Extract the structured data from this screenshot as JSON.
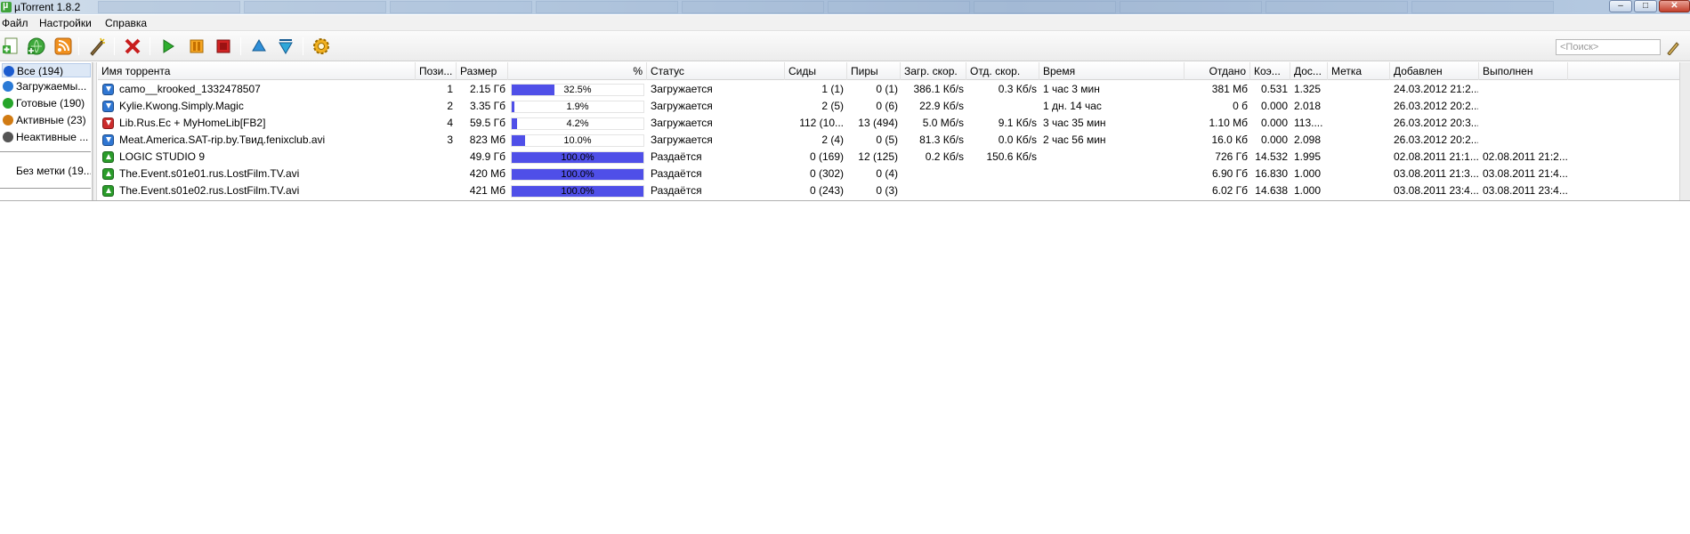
{
  "window": {
    "title": "µTorrent 1.8.2",
    "min": "–",
    "max": "□",
    "close": "✕"
  },
  "menu": [
    "Файл",
    "Настройки",
    "Справка"
  ],
  "toolbar": {
    "search_placeholder": "<Поиск>",
    "icons": [
      "add-torrent-icon",
      "add-url-icon",
      "rss-icon",
      "create-torrent-icon",
      "remove-icon",
      "start-icon",
      "pause-icon",
      "stop-icon",
      "move-up-icon",
      "move-down-icon",
      "settings-icon"
    ]
  },
  "sidebar": {
    "items": [
      {
        "label": "Все (194)",
        "icon": "#1c5ccf",
        "selected": true
      },
      {
        "label": "Загружаемы...",
        "icon": "#2a7ad6"
      },
      {
        "label": "Готовые (190)",
        "icon": "#26a52a"
      },
      {
        "label": "Активные (23)",
        "icon": "#d17b13"
      },
      {
        "label": "Неактивные ...",
        "icon": "#555555"
      },
      {
        "label": "Без метки (19..."
      }
    ]
  },
  "columns": [
    "Имя торрента",
    "Пози...",
    "Размер",
    "%",
    "Статус",
    "Сиды",
    "Пиры",
    "Загр. скор.",
    "Отд. скор.",
    "Время",
    "Отдано",
    "Коэ...",
    "Дос...",
    "Метка",
    "Добавлен",
    "Выполнен"
  ],
  "colors": {
    "progress": "#4f4fe8",
    "downloading": "#2f76d2",
    "seeding": "#2a9c2a",
    "error": "#cc2b2b"
  },
  "torrents": [
    {
      "icon": "downloading",
      "name": "camo__krooked_1332478507",
      "pos": "1",
      "size": "2.15 Гб",
      "progress": 32.5,
      "pct": "32.5%",
      "status": "Загружается",
      "seeds": "1 (1)",
      "peers": "0 (1)",
      "down": "386.1 Кб/s",
      "up": "0.3 Кб/s",
      "eta": "1 час 3 мин",
      "uploaded": "381 Мб",
      "ratio": "0.531",
      "avail": "1.325",
      "label": "",
      "added": "24.03.2012 21:2...",
      "completed": ""
    },
    {
      "icon": "downloading",
      "name": "Kylie.Kwong.Simply.Magic",
      "pos": "2",
      "size": "3.35 Гб",
      "progress": 1.9,
      "pct": "1.9%",
      "status": "Загружается",
      "seeds": "2 (5)",
      "peers": "0 (6)",
      "down": "22.9 Кб/s",
      "up": "",
      "eta": "1 дн. 14 час",
      "uploaded": "0 б",
      "ratio": "0.000",
      "avail": "2.018",
      "label": "",
      "added": "26.03.2012 20:2...",
      "completed": ""
    },
    {
      "icon": "error",
      "name": "Lib.Rus.Ec + MyHomeLib[FB2]",
      "pos": "4",
      "size": "59.5 Гб",
      "progress": 4.2,
      "pct": "4.2%",
      "status": "Загружается",
      "seeds": "112 (10...",
      "peers": "13 (494)",
      "down": "5.0 Мб/s",
      "up": "9.1 Кб/s",
      "eta": "3 час 35 мин",
      "uploaded": "1.10 Мб",
      "ratio": "0.000",
      "avail": "113....",
      "label": "",
      "added": "26.03.2012 20:3...",
      "completed": ""
    },
    {
      "icon": "downloading",
      "name": "Meat.America.SAT-rip.by.Твид.fenixclub.avi",
      "pos": "3",
      "size": "823 Мб",
      "progress": 10.0,
      "pct": "10.0%",
      "status": "Загружается",
      "seeds": "2 (4)",
      "peers": "0 (5)",
      "down": "81.3 Кб/s",
      "up": "0.0 Кб/s",
      "eta": "2 час 56 мин",
      "uploaded": "16.0 Кб",
      "ratio": "0.000",
      "avail": "2.098",
      "label": "",
      "added": "26.03.2012 20:2...",
      "completed": ""
    },
    {
      "icon": "seeding",
      "name": "LOGIC STUDIO 9",
      "pos": "",
      "size": "49.9 Гб",
      "progress": 100.0,
      "pct": "100.0%",
      "status": "Раздаётся",
      "seeds": "0 (169)",
      "peers": "12 (125)",
      "down": "0.2 Кб/s",
      "up": "150.6 Кб/s",
      "eta": "",
      "uploaded": "726 Гб",
      "ratio": "14.532",
      "avail": "1.995",
      "label": "",
      "added": "02.08.2011 21:1...",
      "completed": "02.08.2011 21:2..."
    },
    {
      "icon": "seeding",
      "name": "The.Event.s01e01.rus.LostFilm.TV.avi",
      "pos": "",
      "size": "420 Мб",
      "progress": 100.0,
      "pct": "100.0%",
      "status": "Раздаётся",
      "seeds": "0 (302)",
      "peers": "0 (4)",
      "down": "",
      "up": "",
      "eta": "",
      "uploaded": "6.90 Гб",
      "ratio": "16.830",
      "avail": "1.000",
      "label": "",
      "added": "03.08.2011 21:3...",
      "completed": "03.08.2011 21:4..."
    },
    {
      "icon": "seeding",
      "name": "The.Event.s01e02.rus.LostFilm.TV.avi",
      "pos": "",
      "size": "421 Мб",
      "progress": 100.0,
      "pct": "100.0%",
      "status": "Раздаётся",
      "seeds": "0 (243)",
      "peers": "0 (3)",
      "down": "",
      "up": "",
      "eta": "",
      "uploaded": "6.02 Гб",
      "ratio": "14.638",
      "avail": "1.000",
      "label": "",
      "added": "03.08.2011 23:4...",
      "completed": "03.08.2011 23:4..."
    }
  ]
}
